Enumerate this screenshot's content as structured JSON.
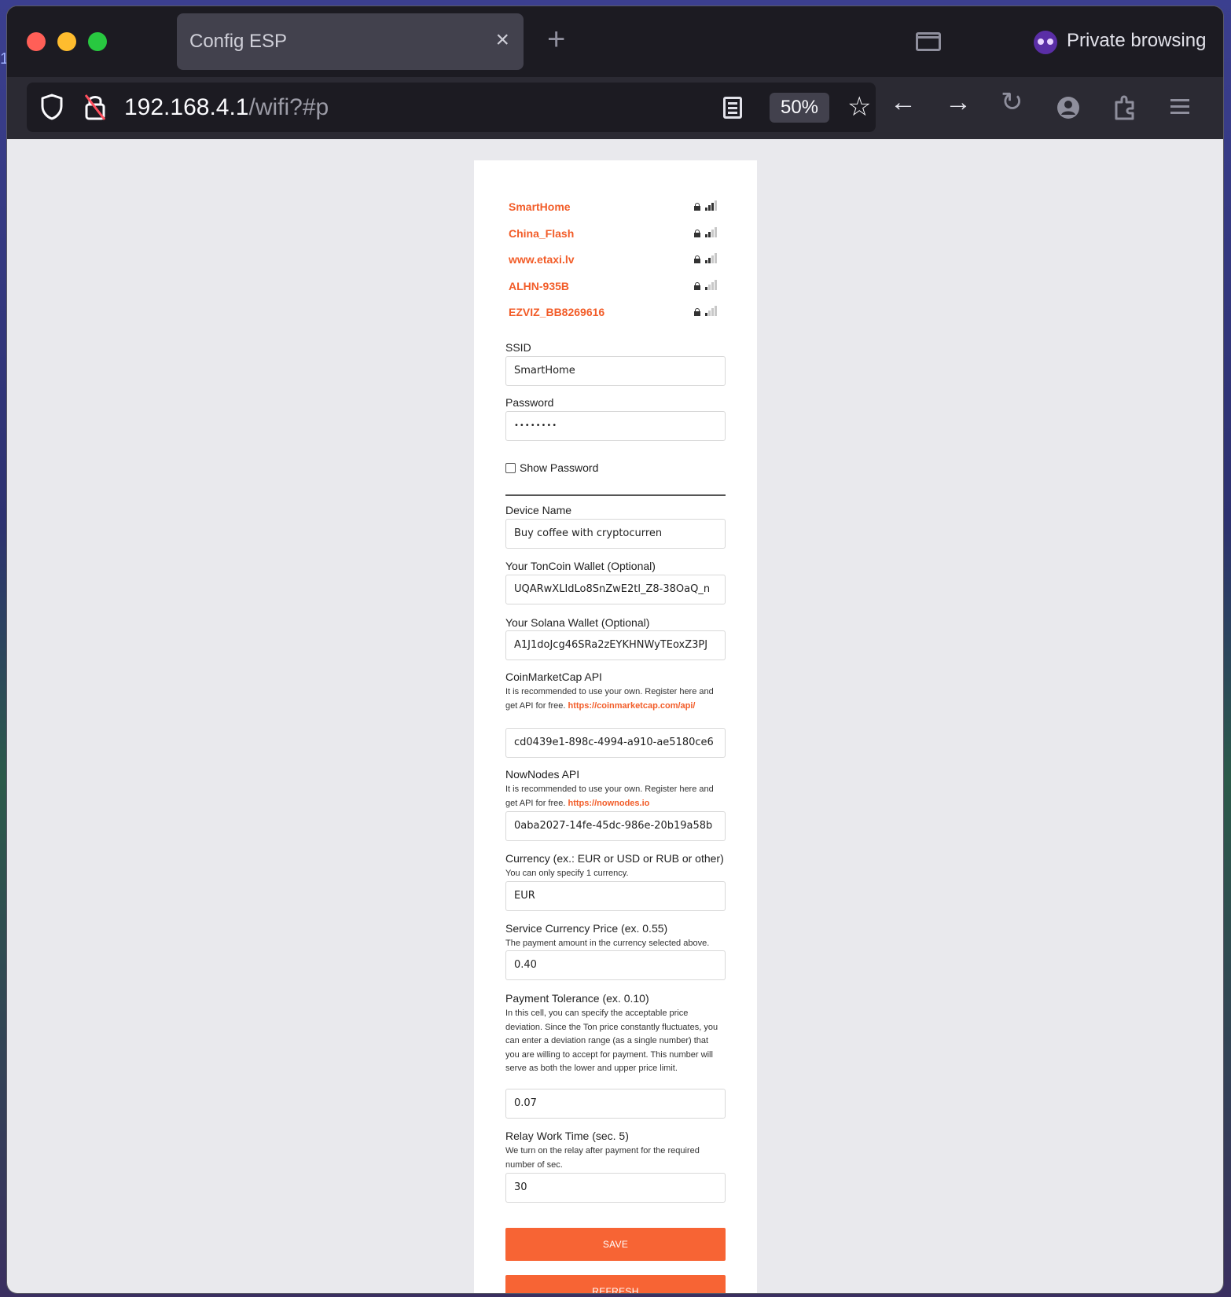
{
  "browser": {
    "tab_title": "Config ESP",
    "tab_close": "×",
    "new_tab": "+",
    "private_label": "Private browsing",
    "url_host": "192.168.4.1",
    "url_path": "/wifi?#p",
    "zoom": "50%",
    "icons": [
      "shield-icon",
      "insecure-lock-icon",
      "reader-view-icon",
      "bookmark-star-icon",
      "back-arrow-icon",
      "forward-arrow-icon",
      "reload-icon",
      "account-icon",
      "extensions-icon",
      "menu-icon"
    ]
  },
  "wifi_networks": [
    {
      "ssid": "SmartHome",
      "signal_bars": 3
    },
    {
      "ssid": "China_Flash",
      "signal_bars": 2
    },
    {
      "ssid": "www.etaxi.lv",
      "signal_bars": 2
    },
    {
      "ssid": "ALHN-935B",
      "signal_bars": 1
    },
    {
      "ssid": "EZVIZ_BB8269616",
      "signal_bars": 1
    }
  ],
  "form": {
    "ssid_label": "SSID",
    "ssid_value": "SmartHome",
    "password_label": "Password",
    "password_value": "••••••••",
    "show_password_label": "Show Password",
    "device_name_label": "Device Name",
    "device_name_value": "Buy coffee with   cryptocurren",
    "ton_wallet_label": "Your TonCoin Wallet (Optional)",
    "ton_wallet_value": "UQARwXLIdLo8SnZwE2tl_Z8-38OaQ_n",
    "solana_wallet_label": "Your Solana Wallet (Optional)",
    "solana_wallet_value": "A1J1doJcg46SRa2zEYKHNWyTEoxZ3PJ",
    "cmc_label": "CoinMarketCap API",
    "cmc_hint": "It is recommended to use your own. Register here and get API for free.",
    "cmc_link": "https://coinmarketcap.com/api/",
    "cmc_value": "cd0439e1-898c-4994-a910-ae5180ce6",
    "nownodes_label": "NowNodes API",
    "nownodes_hint": "It is recommended to use your own. Register here and get API for free.",
    "nownodes_link": "https://nownodes.io",
    "nownodes_value": "0aba2027-14fe-45dc-986e-20b19a58b",
    "currency_label": "Currency (ex.: EUR or USD or RUB or other)",
    "currency_hint": "You can only specify 1 currency.",
    "currency_value": "EUR",
    "price_label": "Service Currency Price (ex. 0.55)",
    "price_hint": "The payment amount in the currency selected above.",
    "price_value": "0.40",
    "tolerance_label": "Payment Tolerance (ex. 0.10)",
    "tolerance_hint": "In this cell, you can specify the acceptable price deviation. Since the Ton price constantly fluctuates, you can enter a deviation range (as a single number) that you are willing to accept for payment. This number will serve as both the lower and upper price limit.",
    "tolerance_value": "0.07",
    "relay_label": "Relay Work Time (sec. 5)",
    "relay_hint": "We turn on the relay after payment for the required number of sec.",
    "relay_value": "30",
    "save_label": "SAVE",
    "refresh_label": "REFRESH"
  },
  "colors": {
    "accent": "#f76434",
    "link": "#f25c28",
    "page_bg": "#e9e9ed"
  }
}
